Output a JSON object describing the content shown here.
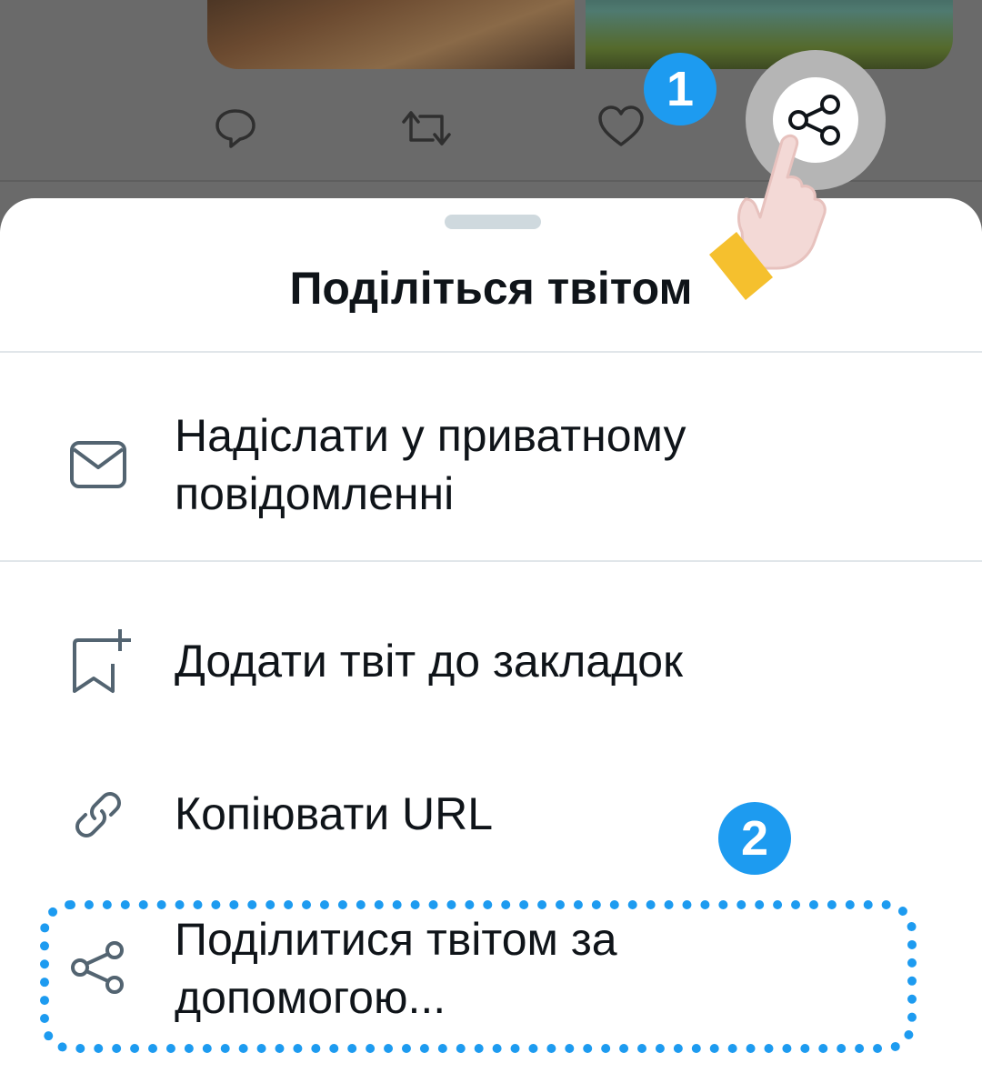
{
  "sheet": {
    "title": "Поділіться твітом",
    "items": [
      {
        "label_line1": "Надіслати у приватному",
        "label_line2": "повідомленні",
        "icon": "envelope-icon"
      },
      {
        "label": "Додати твіт до закладок",
        "icon": "bookmark-add-icon"
      },
      {
        "label": "Копіювати URL",
        "icon": "link-icon"
      },
      {
        "label_line1": "Поділитися твітом за",
        "label_line2": "допомогою...",
        "icon": "share-icon"
      }
    ]
  },
  "badges": {
    "step1": "1",
    "step2": "2"
  },
  "tweet_actions": [
    "reply-icon",
    "retweet-icon",
    "like-icon",
    "share-icon"
  ],
  "colors": {
    "accent": "#1d9bf0",
    "text": "#0f1419",
    "icon": "#536471",
    "backdrop": "#6a6a6a",
    "hand_cuff": "#f5c02e"
  }
}
